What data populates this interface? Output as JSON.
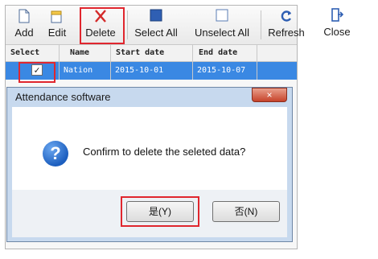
{
  "toolbar": {
    "add": "Add",
    "edit": "Edit",
    "delete": "Delete",
    "select_all": "Select All",
    "unselect_all": "Unselect All",
    "refresh": "Refresh",
    "close": "Close"
  },
  "grid": {
    "headers": [
      "Select",
      "Name",
      "Start date",
      "End date"
    ],
    "rows": [
      {
        "checked": true,
        "name": "Nation",
        "start": "2015-10-01",
        "end": "2015-10-07"
      }
    ],
    "check_mark": "✓"
  },
  "dialog": {
    "title": "Attendance software",
    "close_glyph": "×",
    "icon_glyph": "?",
    "message": "Confirm to delete the seleted data?",
    "yes_label": "是(Y)",
    "no_label": "否(N)"
  },
  "colors": {
    "highlight_red": "#e0262e",
    "selected_row": "#3a88e3",
    "dialog_frame": "#c7d9ee"
  }
}
